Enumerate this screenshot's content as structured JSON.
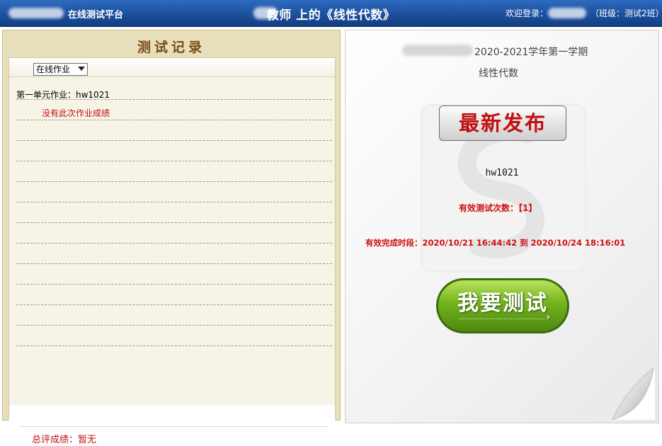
{
  "header": {
    "platform": "在线测试平台",
    "title": "教师 上的《线性代数》",
    "welcome": "欢迎登录：",
    "class_info": "（班级：测试2班）"
  },
  "records": {
    "title": "测试记录",
    "filter_selected": "在线作业",
    "items": [
      {
        "name": "第一单元作业：hw1021",
        "status": "没有此次作业成绩"
      }
    ],
    "overall_score": "总评成绩：暂无"
  },
  "panel": {
    "term": "2020-2021学年第一学期",
    "subject": "线性代数",
    "latest_button": "最新发布",
    "assignment_name": "hw1021",
    "valid_attempts": "有效测试次数：【1】",
    "valid_period": "有效完成时段：2020/10/21 16:44:42 到 2020/10/24 18:16:01",
    "test_button": "我要测试"
  },
  "colors": {
    "header_blue": "#1c4f9c",
    "accent_red": "#c01010",
    "button_green": "#73b21e",
    "panel_beige": "#e6dfba"
  }
}
